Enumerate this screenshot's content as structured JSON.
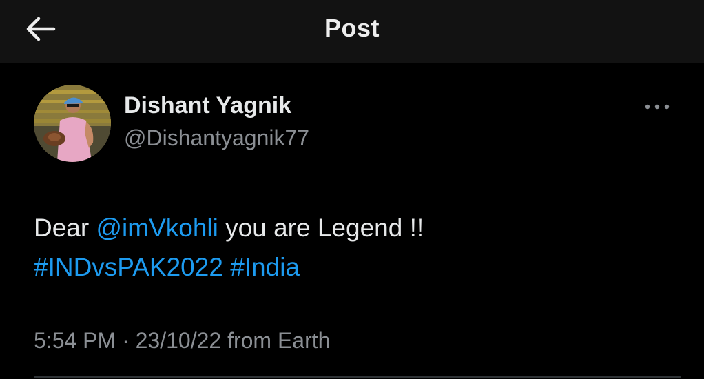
{
  "header": {
    "title": "Post",
    "back_icon": "arrow-left-icon"
  },
  "tweet": {
    "author": {
      "display_name": "Dishant Yagnik",
      "handle": "@Dishantyagnik77",
      "avatar_icon": "avatar-photo"
    },
    "more_icon": "more-horizontal-icon",
    "text": {
      "prefix": "Dear ",
      "mention": "@imVkohli",
      "middle": " you are Legend !!",
      "hashtag1": "#INDvsPAK2022",
      "space": " ",
      "hashtag2": "#India"
    },
    "timestamp": {
      "time": "5:54 PM",
      "separator": " · ",
      "date": "23/10/22",
      "source": " from Earth"
    }
  },
  "colors": {
    "background": "#000000",
    "header_background": "#121212",
    "text_primary": "#e7e9ea",
    "text_secondary": "#8b8f94",
    "link": "#1d9bf0",
    "divider": "#2f3336"
  }
}
